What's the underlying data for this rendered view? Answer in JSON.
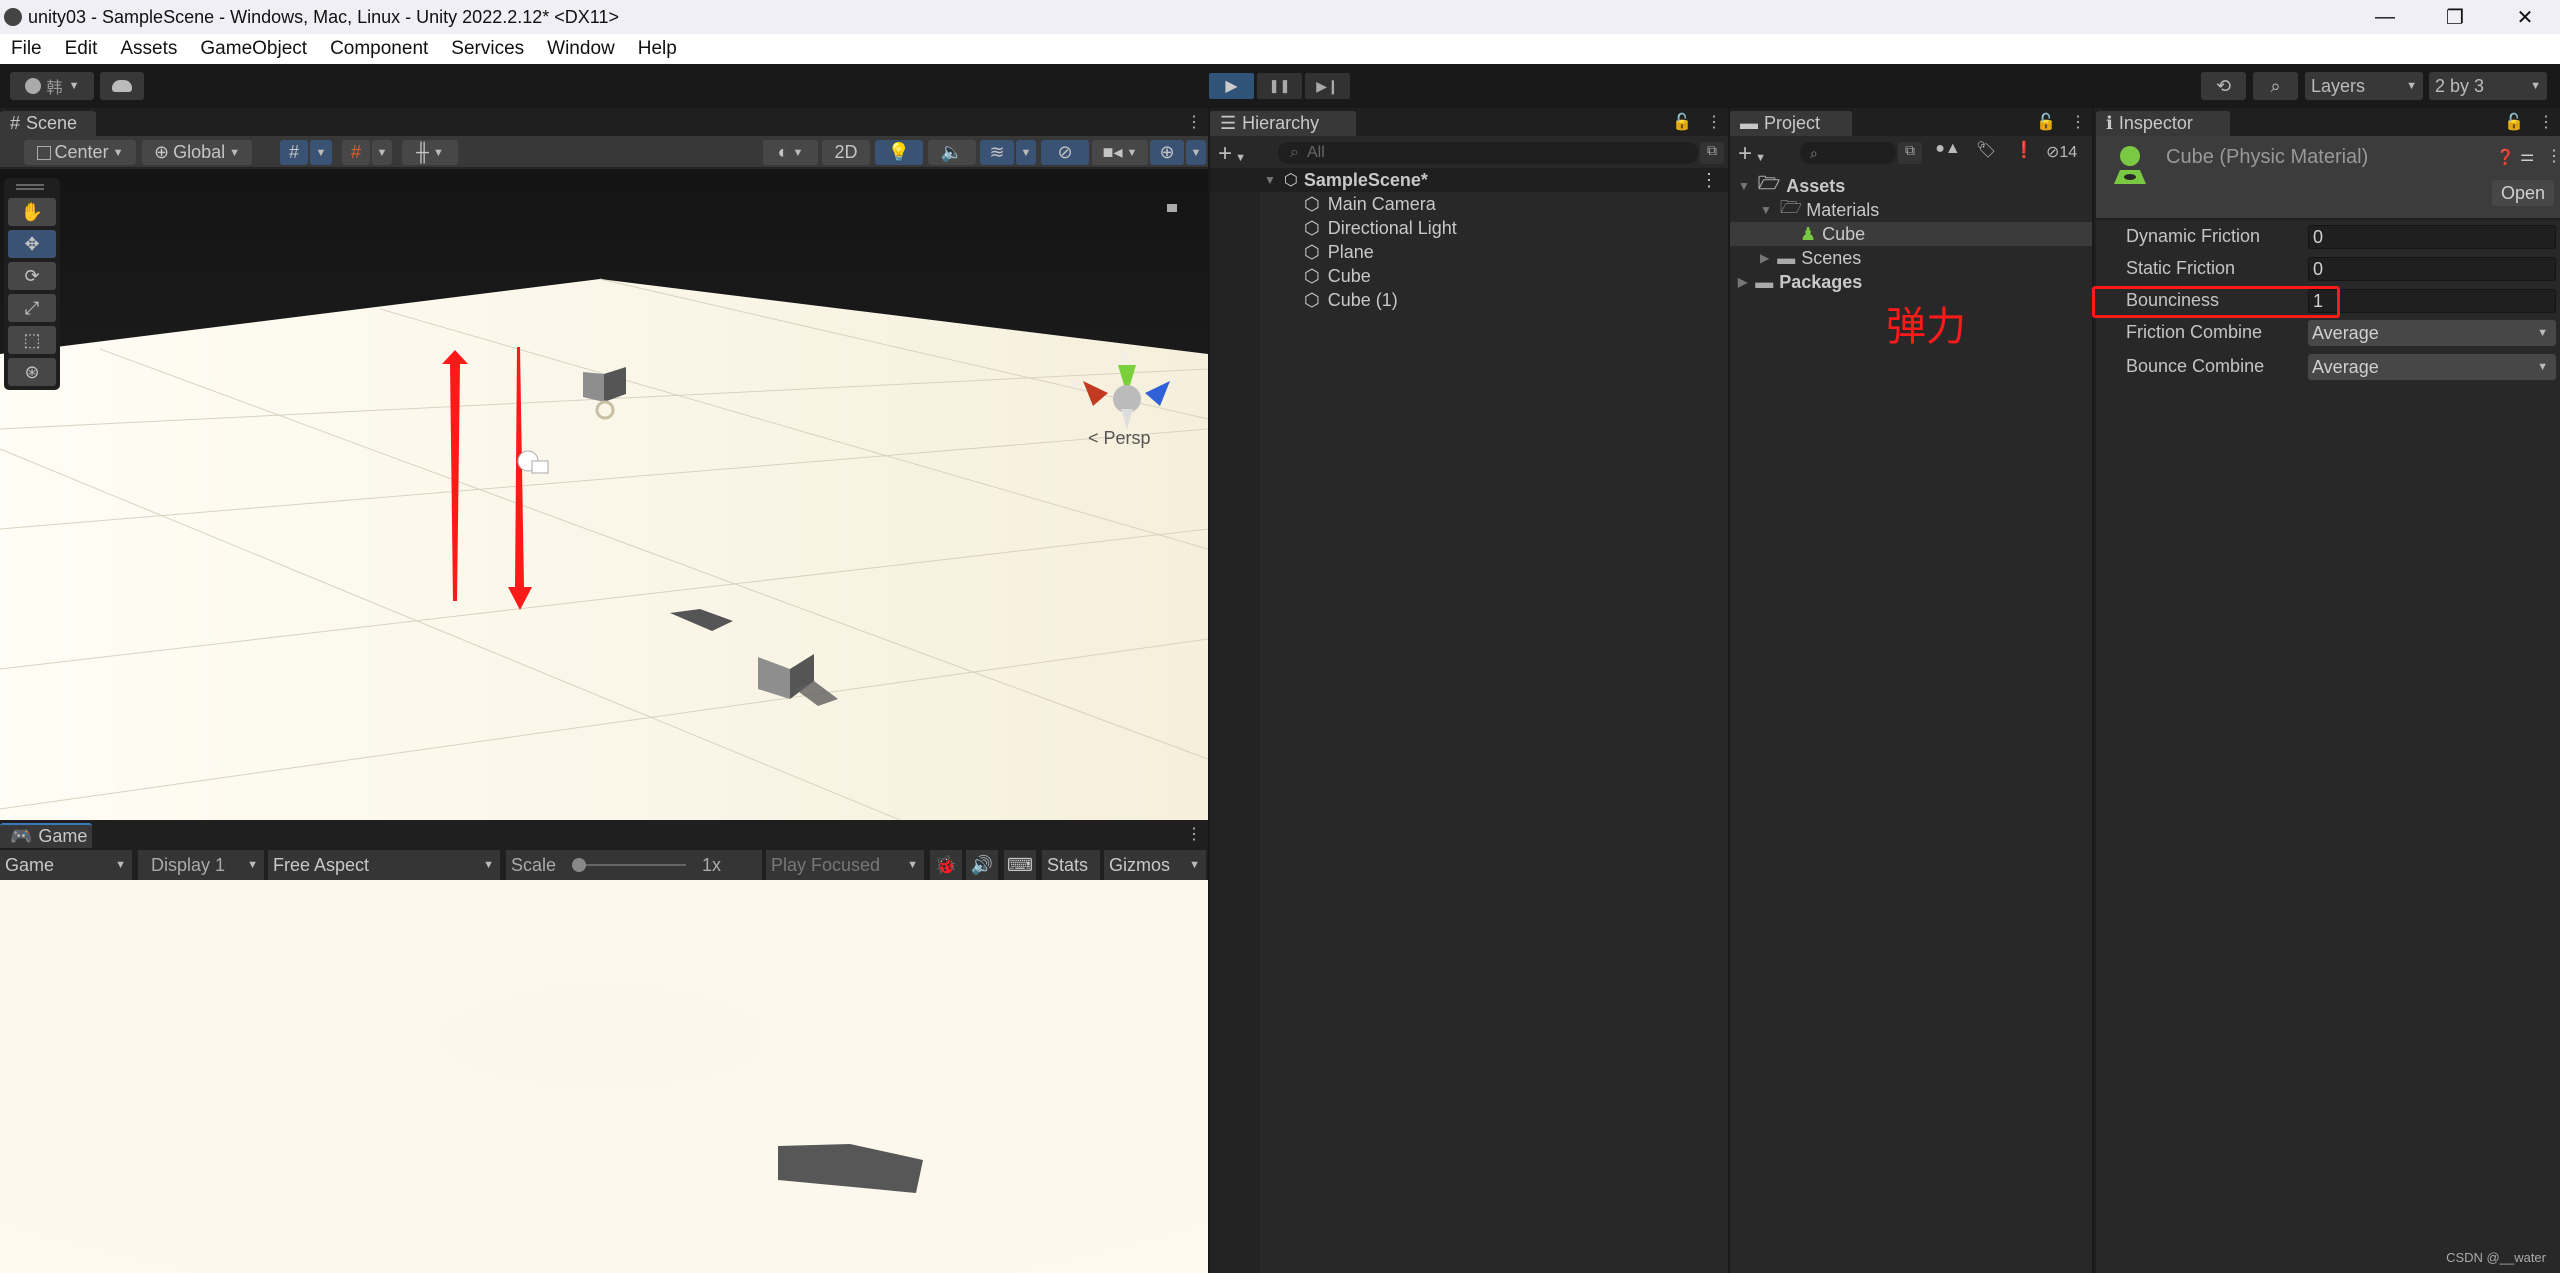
{
  "window": {
    "title": "unity03 - SampleScene - Windows, Mac, Linux - Unity 2022.2.12* <DX11>",
    "controls": {
      "minimize": "—",
      "restore": "❐",
      "close": "✕"
    }
  },
  "menu": [
    "File",
    "Edit",
    "Assets",
    "GameObject",
    "Component",
    "Services",
    "Window",
    "Help"
  ],
  "toolbar": {
    "account_label": "韩",
    "play": "▶",
    "pause": "❚❚",
    "step": "▶❙",
    "layers_label": "Layers",
    "layout_label": "2 by 3"
  },
  "scene": {
    "tab_label": "Scene",
    "pivot_label": "Center",
    "space_label": "Global",
    "mode_2d": "2D",
    "gizmo_axes": {
      "x": "x",
      "y": "y",
      "z": "z"
    },
    "projection_label": "Persp",
    "colors": {
      "ground": "#f7f2e4",
      "sky": "#1a1a1a",
      "arrow": "#ff1a1a",
      "x_axis": "#c23a22",
      "y_axis": "#7ad03a",
      "z_axis": "#2f62d8"
    }
  },
  "game": {
    "tab_label": "Game",
    "view_select": "Game",
    "display_select": "Display 1",
    "aspect_select": "Free Aspect",
    "scale_label": "Scale",
    "scale_value": "1x",
    "scale_level": 0,
    "play_focused": "Play Focused",
    "stats_label": "Stats",
    "gizmos_label": "Gizmos"
  },
  "hierarchy": {
    "tab_label": "Hierarchy",
    "search_placeholder": "All",
    "scene_name": "SampleScene*",
    "items": [
      "Main Camera",
      "Directional Light",
      "Plane",
      "Cube",
      "Cube (1)"
    ]
  },
  "project": {
    "tab_label": "Project",
    "hidden_count": "14",
    "tree": [
      {
        "label": "Assets",
        "bold": true,
        "expanded": true,
        "depth": 0
      },
      {
        "label": "Materials",
        "bold": false,
        "expanded": true,
        "depth": 1
      },
      {
        "label": "Cube",
        "bold": false,
        "selected": true,
        "depth": 2
      },
      {
        "label": "Scenes",
        "bold": false,
        "expanded": false,
        "depth": 1
      },
      {
        "label": "Packages",
        "bold": true,
        "expanded": false,
        "depth": 0
      }
    ],
    "annotation": "弹力"
  },
  "inspector": {
    "tab_label": "Inspector",
    "object_title": "Cube (Physic Material)",
    "open_button": "Open",
    "fields": [
      {
        "label": "Dynamic Friction",
        "value": "0",
        "type": "number"
      },
      {
        "label": "Static Friction",
        "value": "0",
        "type": "number"
      },
      {
        "label": "Bounciness",
        "value": "1",
        "type": "number",
        "highlighted": true
      },
      {
        "label": "Friction Combine",
        "value": "Average",
        "type": "dropdown"
      },
      {
        "label": "Bounce Combine",
        "value": "Average",
        "type": "dropdown"
      }
    ],
    "accent": "#ff1a1a",
    "material_icon_color": "#7ac943"
  },
  "watermark": "CSDN @__water"
}
